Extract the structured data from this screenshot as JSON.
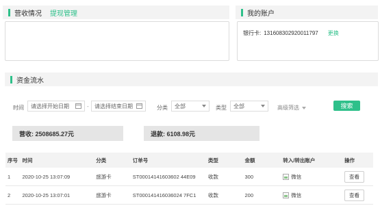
{
  "revenue": {
    "title": "营收情况",
    "withdraw_link": "提现管理"
  },
  "account": {
    "title": "我的账户",
    "bank_label": "银行卡:",
    "bank_number": "131608302920011797",
    "change_link": "更换"
  },
  "flow": {
    "title": "资金流水"
  },
  "filters": {
    "time_label": "时间",
    "start_placeholder": "请选择开始日期",
    "end_placeholder": "请选择结束日期",
    "category_label": "分类",
    "category_value": "全部",
    "type_label": "类型",
    "type_value": "全部",
    "advanced": "高级筛选",
    "search_button": "搜索"
  },
  "summary": {
    "income": "营收: 2508685.27元",
    "refund": "退款: 6108.98元"
  },
  "table": {
    "headers": [
      "序号",
      "时间",
      "分类",
      "订单号",
      "类型",
      "金额",
      "转入/转出账户",
      "操作"
    ],
    "rows": [
      {
        "index": "1",
        "time": "2020-10-25 13:07:09",
        "category": "旅游卡",
        "order": "ST00014141603602 44E09",
        "type": "收款",
        "amount": "300",
        "account": "微信",
        "action": "查看"
      },
      {
        "index": "2",
        "time": "2020-10-25 13:07:01",
        "category": "旅游卡",
        "order": "ST000141416036024 7FC1",
        "type": "收款",
        "amount": "200",
        "account": "微信",
        "action": "查看"
      }
    ]
  },
  "colors": {
    "accent": "#2ec08a",
    "panel_bg": "#f3f3f3",
    "summary_bg": "#e5e5e5"
  },
  "icons": {
    "calendar": "calendar-icon",
    "dropdown": "chevron-down-icon",
    "account_image": "broken-image-icon"
  }
}
